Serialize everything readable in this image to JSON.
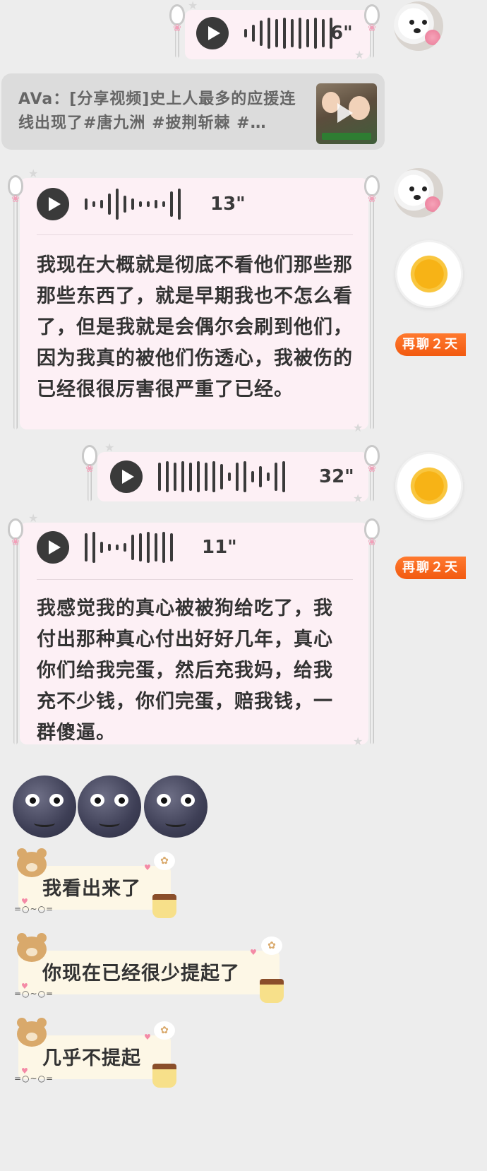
{
  "messages": {
    "voice1": {
      "duration": "6\""
    },
    "share": {
      "text": "AVa：[分享视频]史上人最多的应援连线出现了#唐九洲 #披荆斩棘 #…"
    },
    "voice2": {
      "duration": "13\"",
      "transcript": "我现在大概就是彻底不看他们那些那那些东西了，就是早期我也不怎么看了，但是我就是会偶尔会刷到他们，因为我真的被他们伤透心，我被伤的已经很很厉害很严重了已经。"
    },
    "voice3": {
      "duration": "32\""
    },
    "voice4": {
      "duration": "11\"",
      "transcript": "我感觉我的真心被被狗给吃了，我付出那种真心付出好好几年，真心你们给我完蛋，然后充我妈，给我充不少钱，你们完蛋，赔我钱，一群傻逼。"
    },
    "emoji": [
      "moon-face",
      "moon-face",
      "moon-face"
    ],
    "texts": [
      {
        "text": "我看出来了"
      },
      {
        "text": "你现在已经很少提起了"
      },
      {
        "text": "几乎不提起"
      }
    ],
    "kaomoji": "=○~○="
  },
  "side": {
    "chat_again_label": "再聊２天"
  },
  "icons": {
    "play": "play-icon",
    "avatar": "samoyed-avatar",
    "egg": "fried-egg-sticker"
  }
}
